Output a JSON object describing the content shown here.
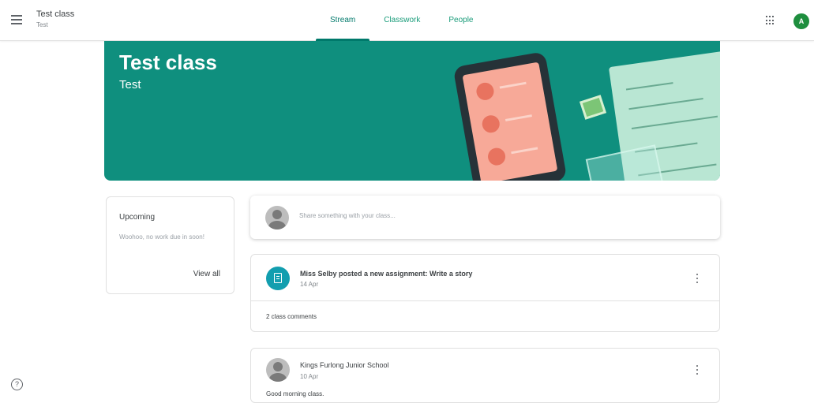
{
  "header": {
    "class_name": "Test class",
    "class_section": "Test",
    "tabs": [
      {
        "label": "Stream",
        "active": true
      },
      {
        "label": "Classwork",
        "active": false
      },
      {
        "label": "People",
        "active": false
      }
    ],
    "apps_icon": "grid-icon",
    "account_initial": "A"
  },
  "banner": {
    "title": "Test class",
    "subtitle": "Test",
    "color": "#0f8f7e"
  },
  "upcoming": {
    "title": "Upcoming",
    "body": "Woohoo, no work due in soon!",
    "link": "View all"
  },
  "share": {
    "placeholder": "Share something with your class..."
  },
  "posts": [
    {
      "title": "Miss Selby posted a new assignment: Write a story",
      "date": "14 Apr",
      "comments": "2 class comments"
    },
    {
      "author": "Kings Furlong Junior School",
      "date": "10 Apr",
      "body": "Good morning class."
    }
  ],
  "colors": {
    "accent": "#00796b",
    "assignment": "#129eaf",
    "avatar": "#1e8e3e"
  }
}
